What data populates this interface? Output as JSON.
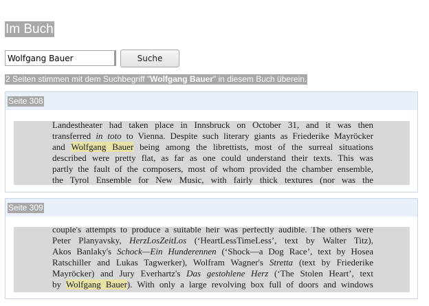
{
  "heading": "Im Buch",
  "search": {
    "value": "Wolfgang Bauer",
    "button_label": "Suche"
  },
  "summary": {
    "prefix": "2 Seiten stimmen mit dem Suchbegriff \"",
    "term": "Wolfgang Bauer",
    "suffix": "\" in diesem Buch überein."
  },
  "results": [
    {
      "page_label": "Seite 308",
      "lines": [
        [
          {
            "t": "Landestheater had taken place in Innsbruck on October 31, and it was then"
          }
        ],
        [
          {
            "t": "transferred "
          },
          {
            "t": "in toto",
            "i": true
          },
          {
            "t": " to Vienna. Despite such literary giants as Friederike Mayröcker"
          }
        ],
        [
          {
            "t": "and "
          },
          {
            "t": "Wolfgang Bauer",
            "h": true
          },
          {
            "t": " being among the librettists, most of the surreal situations"
          }
        ],
        [
          {
            "t": "described were pretty flat, as far as one could understand their texts. This was"
          }
        ],
        [
          {
            "t": "partly the fault of the composers, most of whom provided the chamber ensemble,"
          }
        ],
        [
          {
            "t": "the Tyrol Ensemble for New Music, with fairly thick textures (nor was the"
          }
        ]
      ]
    },
    {
      "page_label": "Seite 309",
      "lines": [
        [
          {
            "t": "couple's attempts to produce a suitable heir was perfectly audible. The others were"
          }
        ],
        [
          {
            "t": "Peter Planyavsky, "
          },
          {
            "t": "HerzLosZeitLos",
            "i": true
          },
          {
            "t": " (‘HeartLessTimeLess’, text by Walter Titz),"
          }
        ],
        [
          {
            "t": "Akos Banlaky's "
          },
          {
            "t": "Schock—Ein Hunderennen",
            "i": true
          },
          {
            "t": " (‘Shock—a Dog Race’, text by Hosea"
          }
        ],
        [
          {
            "t": "Ratschiller and Lukas Tagwerker), Wolfram Wagner's "
          },
          {
            "t": "Stretta",
            "i": true
          },
          {
            "t": " (text by Friederike"
          }
        ],
        [
          {
            "t": "Mayröcker) and Jury Everhartz's "
          },
          {
            "t": "Das gestohlene Herz",
            "i": true
          },
          {
            "t": " (‘The Stolen Heart’, text"
          }
        ],
        [
          {
            "t": "by "
          },
          {
            "t": "Wolfgang Bauer",
            "h": true
          },
          {
            "t": "). With only a large revolving box full of doors and windows"
          }
        ]
      ]
    }
  ]
}
